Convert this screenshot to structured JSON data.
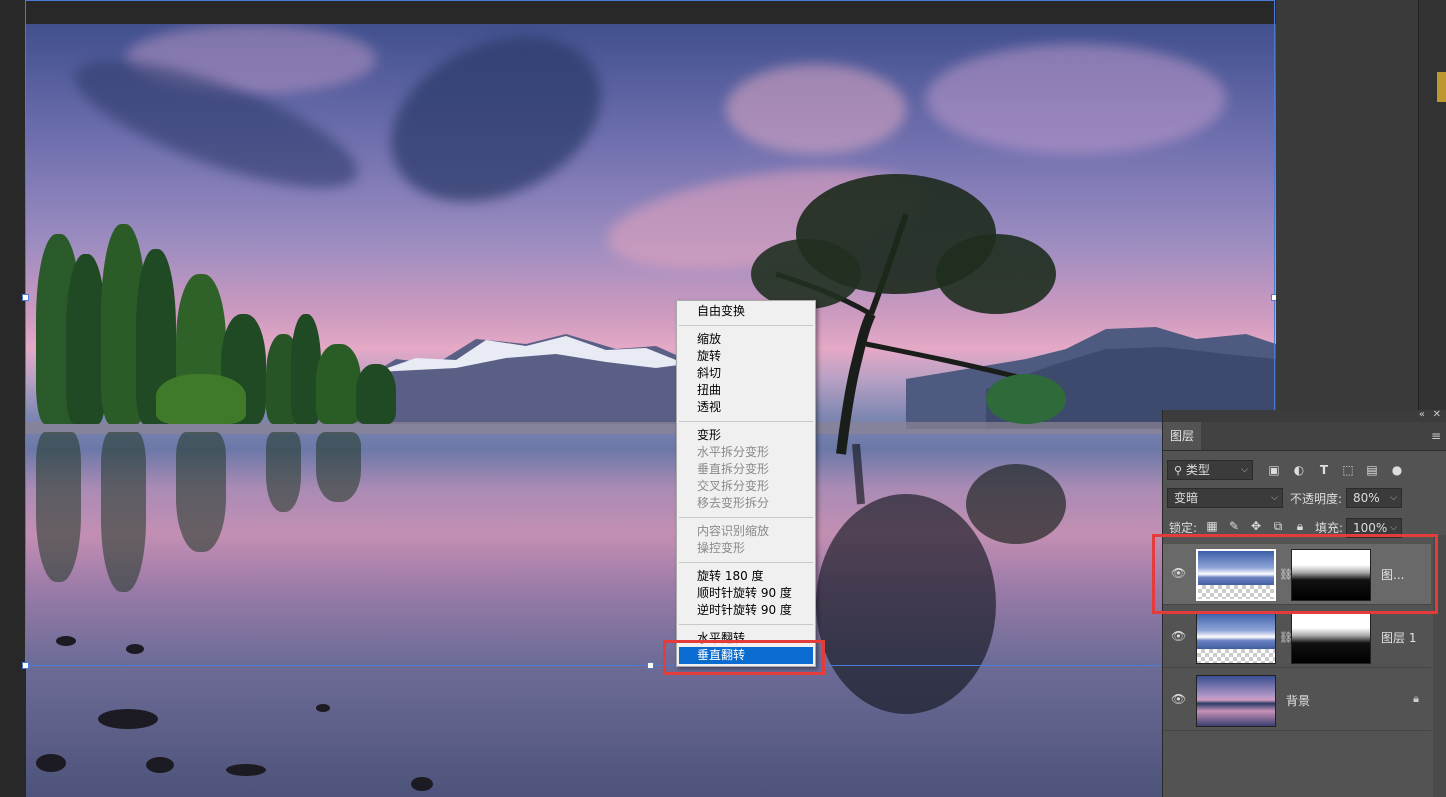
{
  "context_menu": {
    "items": [
      {
        "label": "自由变换",
        "enabled": true
      },
      {
        "label": "缩放",
        "enabled": true
      },
      {
        "label": "旋转",
        "enabled": true
      },
      {
        "label": "斜切",
        "enabled": true
      },
      {
        "label": "扭曲",
        "enabled": true
      },
      {
        "label": "透视",
        "enabled": true
      },
      {
        "label": "变形",
        "enabled": true
      },
      {
        "label": "水平拆分变形",
        "enabled": false
      },
      {
        "label": "垂直拆分变形",
        "enabled": false
      },
      {
        "label": "交叉拆分变形",
        "enabled": false
      },
      {
        "label": "移去变形拆分",
        "enabled": false
      },
      {
        "label": "内容识别缩放",
        "enabled": false
      },
      {
        "label": "操控变形",
        "enabled": false
      },
      {
        "label": "旋转 180 度",
        "enabled": true
      },
      {
        "label": "顺时针旋转 90 度",
        "enabled": true
      },
      {
        "label": "逆时针旋转 90 度",
        "enabled": true
      },
      {
        "label": "水平翻转",
        "enabled": true
      },
      {
        "label": "垂直翻转",
        "enabled": true,
        "highlighted": true
      }
    ]
  },
  "layers_panel": {
    "collapse_icon": "double-chevron-left",
    "close_icon": "close",
    "tab": "图层",
    "menu_icon": "hamburger",
    "filter": {
      "label": "类型",
      "search_icon": "search"
    },
    "filter_icons": [
      "image-filter",
      "adjustment-filter",
      "type-filter",
      "shape-filter",
      "smart-object-filter",
      "filter-toggle"
    ],
    "blend_mode": "变暗",
    "opacity_label": "不透明度:",
    "opacity_value": "80%",
    "lock_label": "锁定:",
    "lock_icons": [
      "lock-transparent-pixels",
      "lock-image-pixels",
      "lock-position",
      "lock-artboard",
      "lock-all"
    ],
    "fill_label": "填充:",
    "fill_value": "100%",
    "layers": [
      {
        "name": "图...",
        "visible": true,
        "selected": true,
        "has_mask": true
      },
      {
        "name": "图层 1",
        "visible": true,
        "selected": false,
        "has_mask": true
      },
      {
        "name": "背景",
        "visible": true,
        "selected": false,
        "locked": true
      }
    ]
  },
  "colors": {
    "menu_highlight": "#0a6bd1",
    "annotation_red": "#e43b3b",
    "transform_box": "#4a7bd8",
    "panel_bg": "#535353"
  }
}
